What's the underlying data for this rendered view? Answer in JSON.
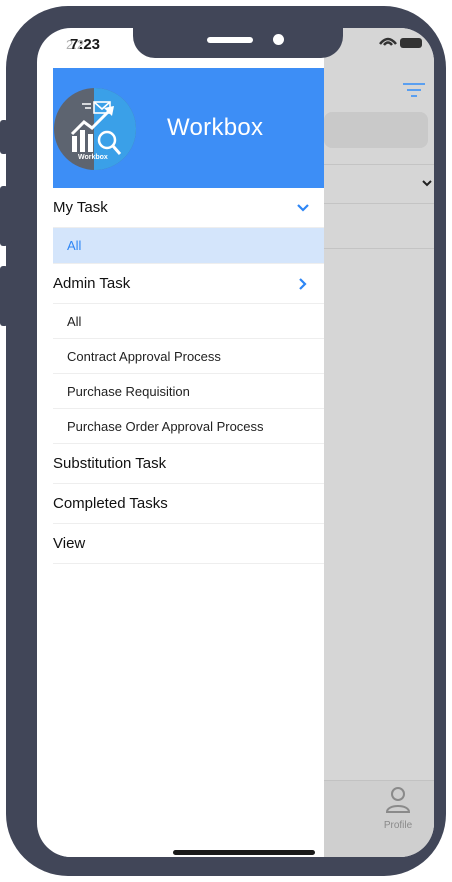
{
  "status_bar": {
    "time": "7:23",
    "time_ghost": "2:22"
  },
  "drawer": {
    "brand_title": "Workbox",
    "logo_text": "Workbox",
    "menu": [
      {
        "label": "My Task",
        "expanded": true
      },
      {
        "label": "All",
        "selected": true
      },
      {
        "label": "Admin Task",
        "expanded": false
      },
      {
        "label": "All"
      },
      {
        "label": "Contract Approval Process"
      },
      {
        "label": "Purchase Requisition"
      },
      {
        "label": "Purchase Order Approval Process"
      },
      {
        "label": "Substitution Task"
      },
      {
        "label": "Completed Tasks"
      },
      {
        "label": "View"
      }
    ]
  },
  "background": {
    "tab_profile_label": "Profile"
  },
  "colors": {
    "accent": "#3d8ef6",
    "selected_bg": "#d4e5fb",
    "selected_text": "#2e86f5",
    "frame": "#414658"
  }
}
